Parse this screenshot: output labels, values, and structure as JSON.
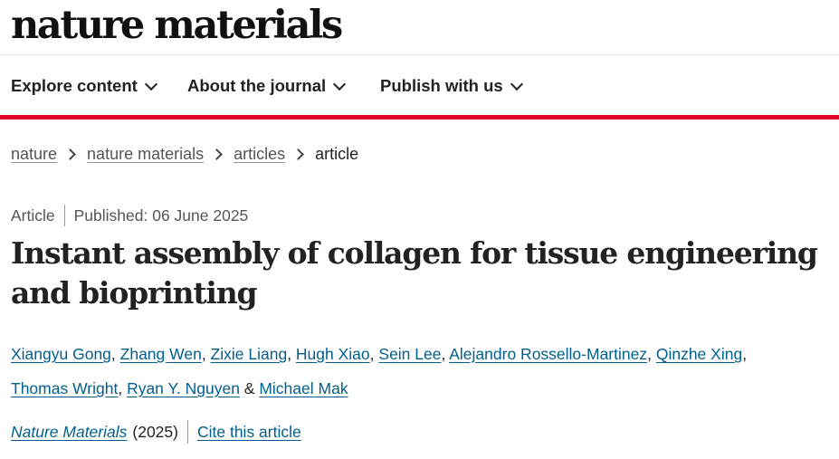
{
  "header": {
    "logo_text": "nature materials"
  },
  "nav": {
    "items": [
      {
        "label": "Explore content"
      },
      {
        "label": "About the journal"
      },
      {
        "label": "Publish with us"
      }
    ]
  },
  "colors": {
    "accent_rule": "#e0002a",
    "link": "#025e8d"
  },
  "breadcrumb": {
    "items": [
      {
        "label": "nature",
        "link": true
      },
      {
        "label": "nature materials",
        "link": true
      },
      {
        "label": "articles",
        "link": true
      },
      {
        "label": "article",
        "link": false
      }
    ]
  },
  "article": {
    "type": "Article",
    "published": "Published: 06 June 2025",
    "title": "Instant assembly of collagen for tissue engineering and bioprinting",
    "authors": [
      "Xiangyu Gong",
      "Zhang Wen",
      "Zixie Liang",
      "Hugh Xiao",
      "Sein Lee",
      "Alejandro Rossello-Martinez",
      "Qinzhe Xing",
      "Thomas Wright",
      "Ryan Y. Nguyen",
      "Michael Mak"
    ],
    "author_separator": ",",
    "author_final_separator": "&",
    "journal": "Nature Materials",
    "year": "(2025)",
    "cite_label": "Cite this article"
  },
  "icons": {
    "nav_dropdown": "chevron-down-icon",
    "breadcrumb_separator": "chevron-right-icon"
  }
}
